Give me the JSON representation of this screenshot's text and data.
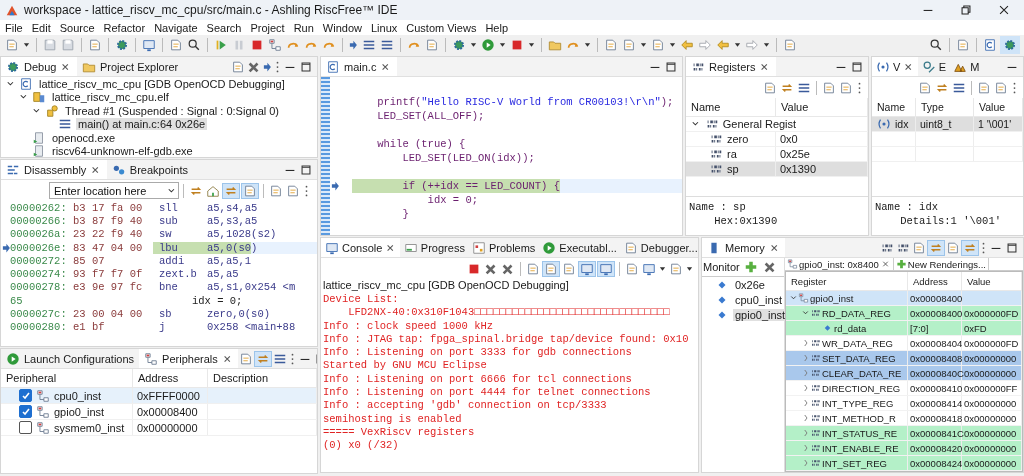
{
  "window": {
    "title": "workspace - lattice_riscv_mc_cpu/src/main.c - Ashling RiscFree™ IDE"
  },
  "menu": [
    "File",
    "Edit",
    "Source",
    "Refactor",
    "Navigate",
    "Search",
    "Project",
    "Run",
    "Window",
    "Linux",
    "Custom Views",
    "Help"
  ],
  "debug": {
    "tabs": [
      {
        "label": "Debug",
        "selected": true
      },
      {
        "label": "Project Explorer",
        "selected": false
      }
    ],
    "tree": [
      {
        "label": "lattice_riscv_mc_cpu [GDB OpenOCD Debugging]",
        "kind": "launch",
        "expanded": true,
        "selected": false,
        "children": [
          {
            "label": "lattice_riscv_mc_cpu.elf",
            "kind": "target",
            "expanded": true,
            "selected": false,
            "children": [
              {
                "label": "Thread #1 (Suspended : Signal : 0:Signal 0)",
                "kind": "thread",
                "expanded": true,
                "selected": false,
                "children": [
                  {
                    "label": "main() at main.c:64 0x26e",
                    "kind": "frame",
                    "selected": true
                  }
                ]
              }
            ]
          },
          {
            "label": "openocd.exe",
            "kind": "process",
            "selected": false
          },
          {
            "label": "riscv64-unknown-elf-gdb.exe",
            "kind": "process",
            "selected": false
          }
        ]
      }
    ]
  },
  "disassembly": {
    "tabs": [
      {
        "label": "Disassembly",
        "selected": true
      },
      {
        "label": "Breakpoints",
        "selected": false
      }
    ],
    "location": {
      "placeholder": "Enter location here"
    },
    "rows": [
      {
        "kind": "instruction",
        "address": "00000262:",
        "bytes": "b3 17 fa 00",
        "mnemonic": "sll",
        "operands": "a5,s4,a5",
        "current": false
      },
      {
        "kind": "instruction",
        "address": "00000266:",
        "bytes": "b3 87 f9 40",
        "mnemonic": "sub",
        "operands": "a5,s3,a5",
        "current": false
      },
      {
        "kind": "instruction",
        "address": "0000026a:",
        "bytes": "23 22 f9 40",
        "mnemonic": "sw",
        "operands": "a5,1028(s2)",
        "current": false
      },
      {
        "kind": "instruction",
        "address": "0000026e:",
        "bytes": "83 47 04 00",
        "mnemonic": "lbu",
        "operands": "a5,0(s0)",
        "current": true
      },
      {
        "kind": "instruction",
        "address": "00000272:",
        "bytes": "85 07",
        "mnemonic": "addi",
        "operands": "a5,a5,1",
        "current": false
      },
      {
        "kind": "instruction",
        "address": "00000274:",
        "bytes": "93 f7 f7 0f",
        "mnemonic": "zext.b",
        "operands": "a5,a5",
        "current": false
      },
      {
        "kind": "instruction",
        "address": "00000278:",
        "bytes": "e3 9e 97 fc",
        "mnemonic": "bne",
        "operands": "a5,s1,0x254 <m",
        "current": false
      },
      {
        "kind": "source",
        "line": "65",
        "code": "idx = 0;"
      },
      {
        "kind": "instruction",
        "address": "0000027c:",
        "bytes": "23 00 04 00",
        "mnemonic": "sb",
        "operands": "zero,0(s0)",
        "current": false
      },
      {
        "kind": "instruction",
        "address": "00000280:",
        "bytes": "e1 bf",
        "mnemonic": "j",
        "operands": "0x258 <main+88",
        "current": false
      }
    ]
  },
  "peripherals": {
    "tabs": [
      {
        "label": "Launch Configurations",
        "selected": false
      },
      {
        "label": "Peripherals",
        "selected": true
      }
    ],
    "columns": [
      "Peripheral",
      "Address",
      "Description"
    ],
    "rows": [
      {
        "name": "cpu0_inst",
        "address": "0xFFFF0000",
        "checked": true,
        "selected": true
      },
      {
        "name": "gpio0_inst",
        "address": "0x00008400",
        "checked": true,
        "selected": false
      },
      {
        "name": "sysmem0_inst",
        "address": "0x00000000",
        "checked": false,
        "selected": false
      }
    ]
  },
  "editor": {
    "tabs": [
      {
        "label": "main.c",
        "selected": true
      }
    ],
    "lines": [
      {
        "gap_before": true,
        "current": false,
        "parts": [
          {
            "text": "    printf(",
            "kind": "code"
          },
          {
            "text": "\"Hello RISC-V World from CR00103!\\r\\n\"",
            "kind": "string"
          },
          {
            "text": ");",
            "kind": "code"
          }
        ]
      },
      {
        "gap_before": false,
        "current": false,
        "parts": [
          {
            "text": "    LED_SET(ALL_OFF);",
            "kind": "code"
          }
        ]
      },
      {
        "gap_before": true,
        "current": false,
        "parts": [
          {
            "text": "    while (true) {",
            "kind": "code"
          }
        ]
      },
      {
        "gap_before": false,
        "current": false,
        "parts": [
          {
            "text": "        LED_SET(LED_ON(idx));",
            "kind": "code"
          }
        ]
      },
      {
        "gap_before": true,
        "current": true,
        "parts": [
          {
            "text": "        if (++idx == LED_COUNT) {",
            "kind": "code"
          }
        ]
      },
      {
        "gap_before": false,
        "current": false,
        "parts": [
          {
            "text": "            idx = 0;",
            "kind": "code"
          }
        ]
      },
      {
        "gap_before": false,
        "current": false,
        "parts": [
          {
            "text": "        }",
            "kind": "code"
          }
        ]
      }
    ]
  },
  "registers": {
    "tabs": [
      {
        "label": "Registers",
        "selected": true
      }
    ],
    "columns": [
      "Name",
      "Value"
    ],
    "group": {
      "label": "General Regist",
      "expanded": true
    },
    "rows": [
      {
        "name": "zero",
        "value": "0x0",
        "selected": false
      },
      {
        "name": "ra",
        "value": "0x25e",
        "selected": false
      },
      {
        "name": "sp",
        "value": "0x1390",
        "selected": true
      }
    ],
    "details": [
      "Name : sp",
      "    Hex:0x1390"
    ]
  },
  "variables": {
    "tabs": [
      {
        "label": "V",
        "selected": true
      },
      {
        "label": "E",
        "selected": false
      },
      {
        "label": "M",
        "selected": false
      }
    ],
    "columns": [
      "Name",
      "Type",
      "Value"
    ],
    "rows": [
      {
        "name": "idx",
        "type": "uint8_t",
        "value": "1 '\\001'",
        "selected": true
      }
    ],
    "details": [
      "Name : idx",
      "    Details:1 '\\001'"
    ]
  },
  "console": {
    "tabs": [
      {
        "label": "Console",
        "selected": true
      },
      {
        "label": "Progress",
        "selected": false
      },
      {
        "label": "Problems",
        "selected": false
      },
      {
        "label": "Executabl...",
        "selected": false
      },
      {
        "label": "Debugger...",
        "selected": false
      }
    ],
    "subtitle": "lattice_riscv_mc_cpu [GDB OpenOCD Debugging]",
    "lines": [
      "Device List:",
      "    LFD2NX-40:0x310F1043□□□□□□□□□□□□□□□□□□□□□□□□□□□□□□□",
      "Info : clock speed 1000 kHz",
      "Info : JTAG tap: fpga_spinal.bridge tap/device found: 0x10",
      "Info : Listening on port 3333 for gdb connections",
      "Started by GNU MCU Eclipse",
      "Info : Listening on port 6666 for tcl connections",
      "Info : Listening on port 4444 for telnet connections",
      "Info : accepting 'gdb' connection on tcp/3333",
      "semihosting is enabled",
      "===== VexRiscv registers",
      "(0) x0 (/32)"
    ]
  },
  "memory": {
    "tabs": [
      {
        "label": "Memory",
        "selected": true
      }
    ],
    "monitor_label": "Monitor",
    "monitors": [
      {
        "label": "0x26e",
        "selected": false
      },
      {
        "label": "cpu0_inst",
        "selected": false
      },
      {
        "label": "gpio0_inst",
        "selected": true
      }
    ],
    "renderings": [
      {
        "label": "gpio0_inst: 0x8400",
        "selected": true
      },
      {
        "label": "New Renderings...",
        "selected": false
      }
    ],
    "columns": [
      "Register",
      "Address",
      "Value"
    ],
    "rows": [
      {
        "name": "gpio0_inst",
        "address": "0x00008400",
        "kind": "peripheral",
        "expanded": true,
        "selected": true,
        "changed": false,
        "children": [
          {
            "name": "RD_DATA_REG",
            "address": "0x00008400",
            "value": "0x000000FD",
            "kind": "register",
            "expanded": true,
            "selected": false,
            "changed": true,
            "children": [
              {
                "name": "rd_data",
                "address": "[7:0]",
                "value": "0xFD",
                "kind": "field",
                "selected": false,
                "changed": true
              }
            ]
          },
          {
            "name": "WR_DATA_REG",
            "address": "0x00008404",
            "value": "0x000000FD",
            "kind": "register",
            "expanded": false,
            "selected": false,
            "changed": false
          },
          {
            "name": "SET_DATA_REG",
            "address": "0x00008408",
            "value": "0x00000000",
            "kind": "register",
            "expanded": false,
            "selected": true,
            "changed": false
          },
          {
            "name": "CLEAR_DATA_RE",
            "address": "0x0000840C",
            "value": "0x00000000",
            "kind": "register",
            "expanded": false,
            "selected": true,
            "changed": false
          },
          {
            "name": "DIRECTION_REG",
            "address": "0x00008410",
            "value": "0x000000FF",
            "kind": "register",
            "expanded": false,
            "selected": false,
            "changed": false
          },
          {
            "name": "INT_TYPE_REG",
            "address": "0x00008414",
            "value": "0x00000000",
            "kind": "register",
            "expanded": false,
            "selected": false,
            "changed": false
          },
          {
            "name": "INT_METHOD_R",
            "address": "0x00008418",
            "value": "0x00000000",
            "kind": "register",
            "expanded": false,
            "selected": false,
            "changed": false
          },
          {
            "name": "INT_STATUS_RE",
            "address": "0x0000841C",
            "value": "0x00000000",
            "kind": "register",
            "expanded": false,
            "selected": false,
            "changed": true
          },
          {
            "name": "INT_ENABLE_RE",
            "address": "0x00008420",
            "value": "0x00000000",
            "kind": "register",
            "expanded": false,
            "selected": false,
            "changed": true
          },
          {
            "name": "INT_SET_REG",
            "address": "0x00008424",
            "value": "0x00000000",
            "kind": "register",
            "expanded": false,
            "selected": false,
            "changed": true
          }
        ]
      }
    ]
  }
}
